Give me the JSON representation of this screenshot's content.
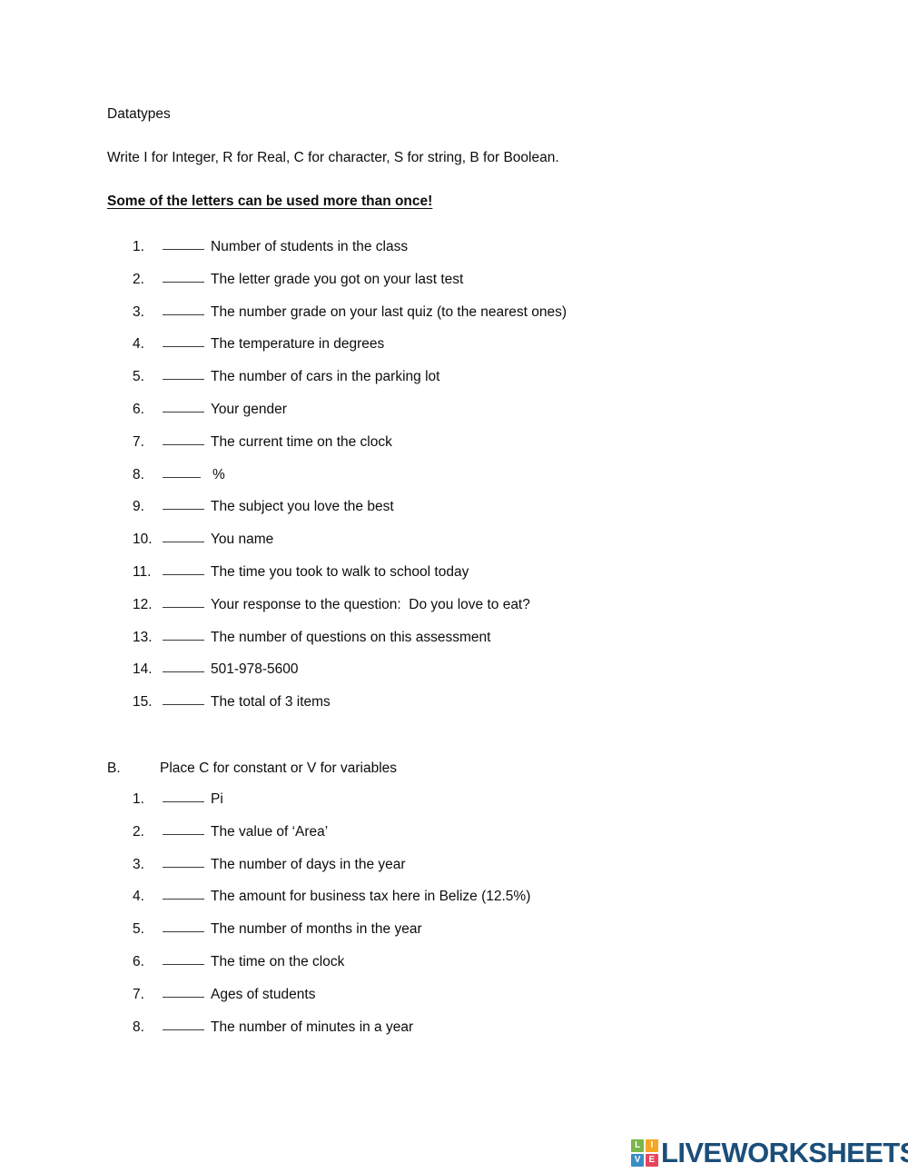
{
  "document": {
    "title": "Datatypes",
    "instruction": "Write I for Integer, R for Real, C for character, S for string, B for Boolean.",
    "emphasis": "Some of the letters can be used more than once!"
  },
  "section_a": {
    "items": [
      {
        "number": "1.",
        "text": "Number of students in the class"
      },
      {
        "number": "2.",
        "text": "The letter grade you got on your last test"
      },
      {
        "number": "3.",
        "text": "The number grade on your last quiz (to the nearest ones)"
      },
      {
        "number": "4.",
        "text": "The temperature in degrees"
      },
      {
        "number": "5.",
        "text": "The number of cars in the parking lot"
      },
      {
        "number": "6.",
        "text": "Your gender"
      },
      {
        "number": "7.",
        "text": "The current time on the clock"
      },
      {
        "number": "8.",
        "text": "%"
      },
      {
        "number": "9.",
        "text": "The subject you love the best"
      },
      {
        "number": "10.",
        "text": "You name"
      },
      {
        "number": "11.",
        "text": "The time you took to walk to school today"
      },
      {
        "number": "12.",
        "text": "Your response to the question:  Do you love to eat?"
      },
      {
        "number": "13.",
        "text": "The number of questions on this assessment"
      },
      {
        "number": "14.",
        "text": "501-978-5600"
      },
      {
        "number": "15.",
        "text": "The total of 3 items"
      }
    ]
  },
  "section_b": {
    "letter": "B.",
    "title": "Place C for constant or V for variables",
    "items": [
      {
        "number": "1.",
        "text": "Pi"
      },
      {
        "number": "2.",
        "text": "The value of ‘Area’"
      },
      {
        "number": "3.",
        "text": "The number of days in the year"
      },
      {
        "number": "4.",
        "text": "The amount for business tax here in Belize (12.5%)"
      },
      {
        "number": "5.",
        "text": "The number of months in the year"
      },
      {
        "number": "6.",
        "text": "The time on the clock"
      },
      {
        "number": "7.",
        "text": "Ages of students"
      },
      {
        "number": "8.",
        "text": "The number of minutes in a year"
      }
    ]
  },
  "logo": {
    "wordmark": "LIVEWORKSHEETS",
    "wordmark_color": "#1b4e79",
    "tiles": [
      {
        "letter": "L",
        "color": "#7ab648"
      },
      {
        "letter": "I",
        "color": "#f5a623"
      },
      {
        "letter": "V",
        "color": "#3a8dc4"
      },
      {
        "letter": "E",
        "color": "#e8445a"
      }
    ]
  }
}
